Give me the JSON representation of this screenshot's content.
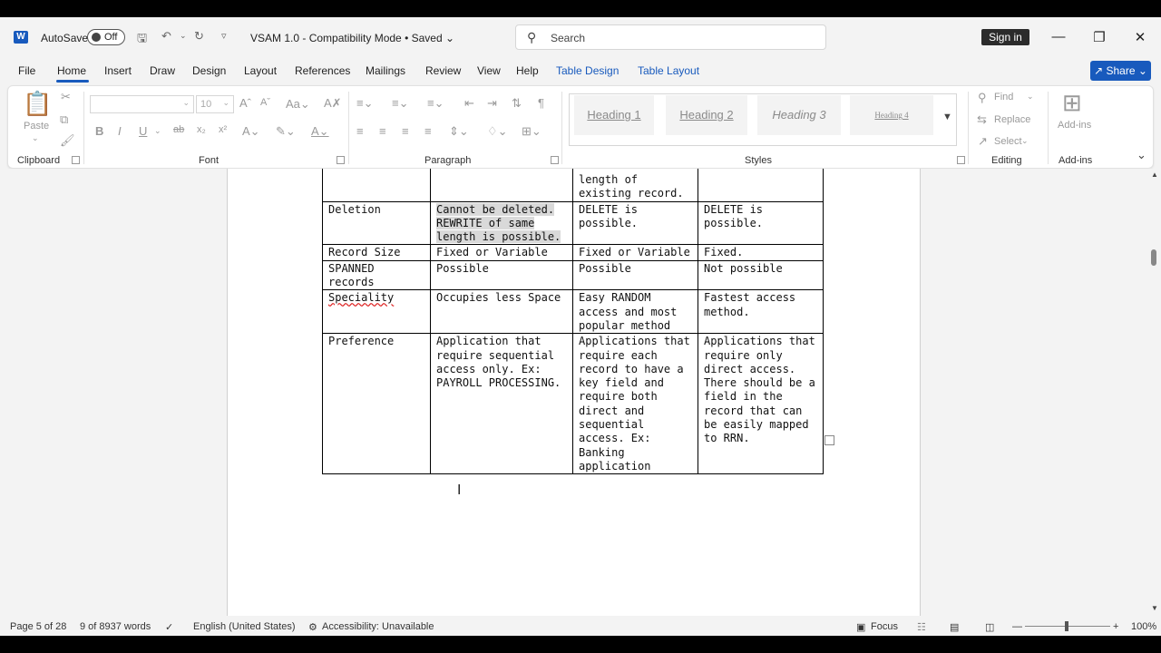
{
  "titlebar": {
    "autosave_label": "AutoSave",
    "autosave_state": "Off",
    "document_title": "VSAM 1.0  -  Compatibility Mode • Saved",
    "search_placeholder": "Search",
    "signin_label": "Sign in"
  },
  "tabs": [
    "File",
    "Home",
    "Insert",
    "Draw",
    "Design",
    "Layout",
    "References",
    "Mailings",
    "Review",
    "View",
    "Help",
    "Table Design",
    "Table Layout"
  ],
  "share_label": "Share",
  "ribbon": {
    "groups": {
      "clipboard": "Clipboard",
      "font": "Font",
      "paragraph": "Paragraph",
      "styles": "Styles",
      "editing": "Editing",
      "addins": "Add-ins"
    },
    "paste_label": "Paste",
    "font_size": "10",
    "styles": [
      "Heading 1",
      "Heading 2",
      "Heading 3",
      "Heading 4"
    ],
    "find_label": "Find",
    "replace_label": "Replace",
    "select_label": "Select",
    "addins_label": "Add-ins"
  },
  "table": {
    "rows": [
      [
        "",
        "",
        "length of existing record.",
        ""
      ],
      [
        "Deletion",
        "Cannot be deleted. REWRITE of same length is possible.",
        "DELETE is possible.",
        "DELETE is possible."
      ],
      [
        "Record Size",
        "Fixed or Variable",
        "Fixed or Variable",
        "Fixed."
      ],
      [
        "SPANNED records",
        "Possible",
        "Possible",
        "Not possible"
      ],
      [
        "Speciality",
        "Occupies less Space",
        "Easy RANDOM access and most popular method",
        "Fastest access method."
      ],
      [
        "Preference",
        "Application that require sequential access only. Ex: PAYROLL PROCESSING.",
        "Applications that require each record to have a key field and require both direct and sequential access. Ex: Banking application",
        "Applications that require only direct access. There should be a field in the record that can be easily mapped to RRN."
      ]
    ]
  },
  "status": {
    "page": "Page 5 of 28",
    "words": "9 of 8937 words",
    "language": "English (United States)",
    "accessibility": "Accessibility: Unavailable",
    "focus": "Focus",
    "zoom": "100%"
  }
}
